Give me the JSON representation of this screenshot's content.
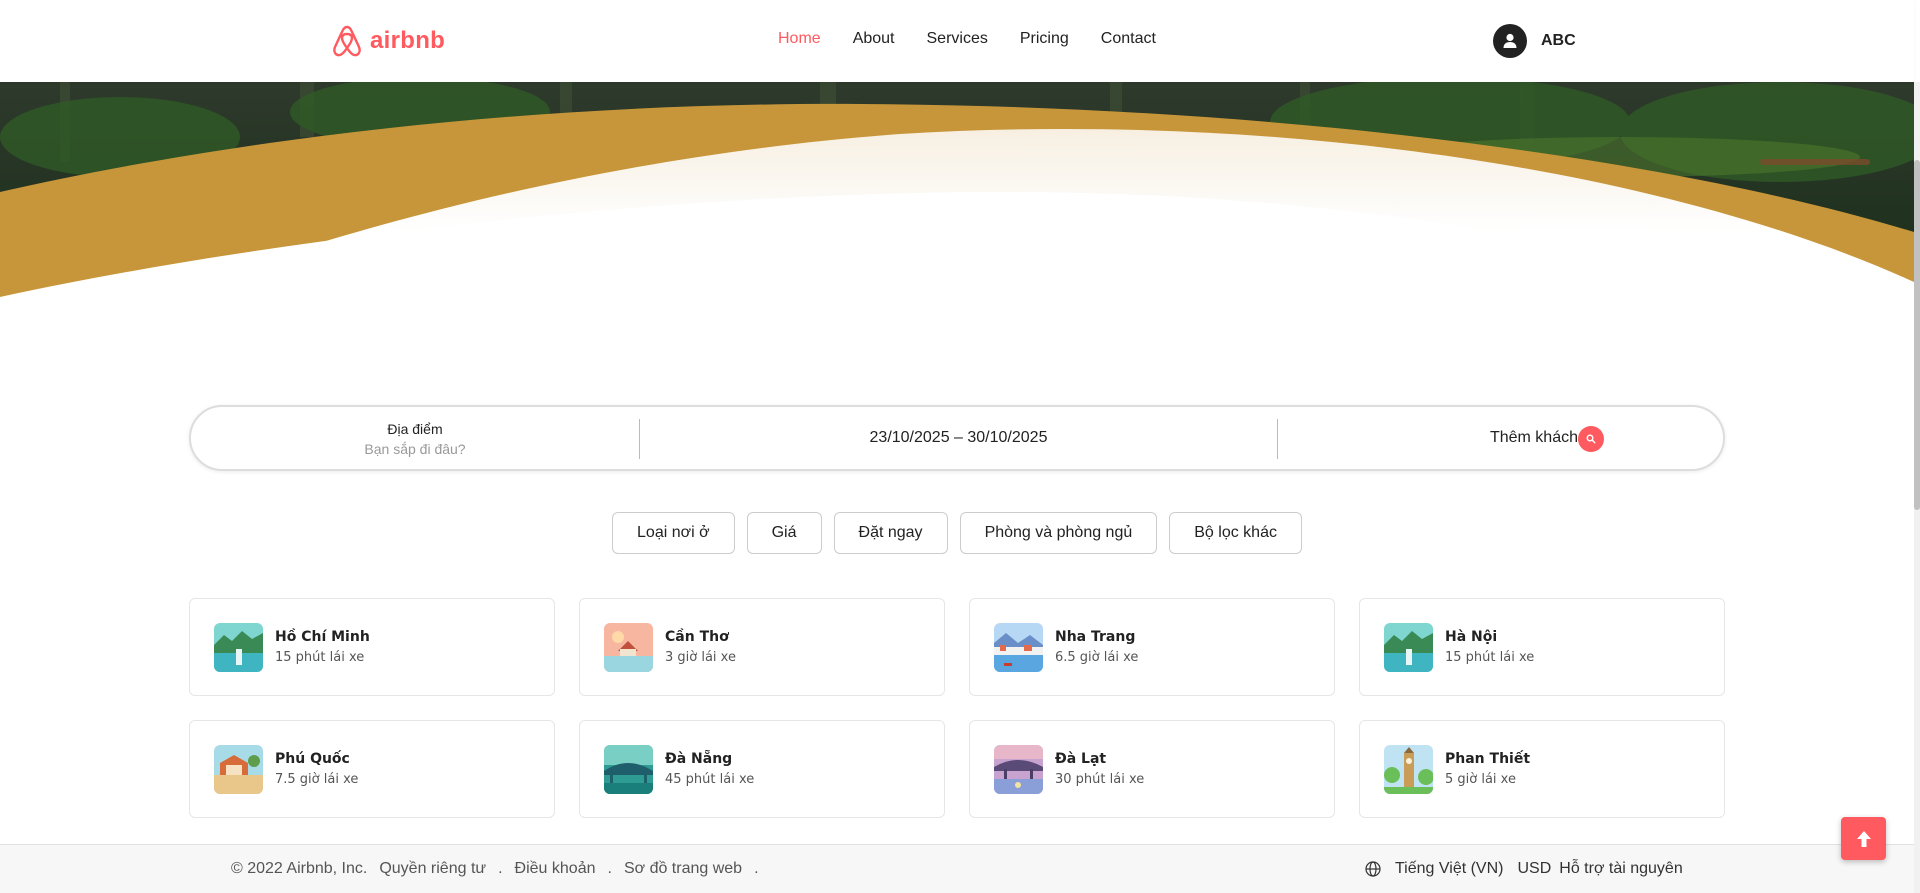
{
  "header": {
    "logo_text": "airbnb",
    "nav": [
      {
        "label": "Home",
        "active": true
      },
      {
        "label": "About"
      },
      {
        "label": "Services"
      },
      {
        "label": "Pricing"
      },
      {
        "label": "Contact"
      }
    ],
    "user_name": "ABC"
  },
  "search": {
    "location_label": "Địa điểm",
    "location_placeholder": "Bạn sắp đi đâu?",
    "date_range": "23/10/2025 – 30/10/2025",
    "guests_label": "Thêm khách"
  },
  "filters": [
    "Loại nơi ở",
    "Giá",
    "Đặt ngay",
    "Phòng và phòng ngủ",
    "Bộ lọc khác"
  ],
  "destinations": [
    {
      "name": "Hồ Chí Minh",
      "distance": "15 phút lái xe"
    },
    {
      "name": "Cần Thơ",
      "distance": "3 giờ lái xe"
    },
    {
      "name": "Nha Trang",
      "distance": "6.5 giờ lái xe"
    },
    {
      "name": "Hà Nội",
      "distance": "15 phút lái xe"
    },
    {
      "name": "Phú Quốc",
      "distance": "7.5 giờ lái xe"
    },
    {
      "name": "Đà Nẵng",
      "distance": "45 phút lái xe"
    },
    {
      "name": "Đà Lạt",
      "distance": "30 phút lái xe"
    },
    {
      "name": "Phan Thiết",
      "distance": "5 giờ lái xe"
    }
  ],
  "footer": {
    "copyright": "© 2022 Airbnb, Inc.",
    "privacy": "Quyền riêng tư",
    "terms": "Điều khoản",
    "sitemap": "Sơ đồ trang web",
    "separator": ".",
    "language": "Tiếng Việt (VN)",
    "currency": "USD",
    "support": "Hỗ trợ tài nguyên"
  },
  "colors": {
    "brand": "#ff5a5f",
    "hero_gold": "#c8963a",
    "forest": "#1f3a22"
  }
}
